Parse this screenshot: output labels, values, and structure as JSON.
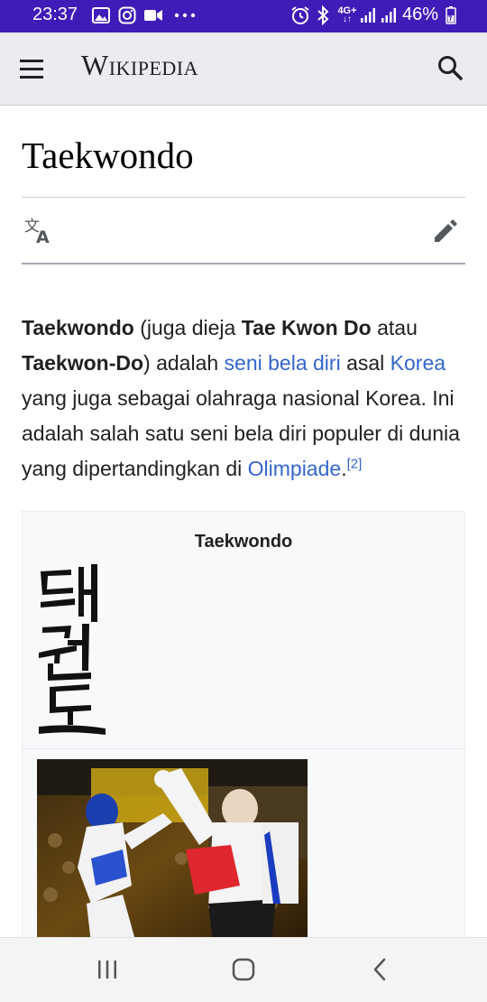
{
  "status_bar": {
    "time": "23:37",
    "network": "4G+",
    "battery": "46%",
    "icons": [
      "gallery-icon",
      "instagram-icon",
      "video-icon",
      "more-icon",
      "alarm-icon",
      "bluetooth-icon",
      "network-icon",
      "signal-icon",
      "signal-icon",
      "battery-icon"
    ],
    "background": "#3f1bb8"
  },
  "header": {
    "wordmark": "Wikipedia",
    "menu_icon": "menu-icon",
    "search_icon": "search-icon",
    "background": "#eaecf0"
  },
  "article": {
    "title": "Taekwondo",
    "language_icon": "language-icon",
    "edit_icon": "edit-icon",
    "lead": {
      "t1": "Taekwondo",
      "t2": " (juga dieja ",
      "t3": "Tae Kwon Do",
      "t4": " atau ",
      "t5": "Taekwon-Do",
      "t6": ") adalah ",
      "link1": "seni bela diri",
      "t7": " asal ",
      "link2": "Korea",
      "t8": " yang juga sebagai olahraga nasional Korea. Ini adalah salah satu seni bela diri populer di dunia yang dipertandingkan di ",
      "link3": "Olimpiade",
      "t9": ".",
      "ref": "[2]"
    },
    "link_color": "#3366cc"
  },
  "infobox": {
    "title": "Taekwondo",
    "hangul_text": "태권도"
  },
  "nav_bar": {
    "icons": [
      "recents-icon",
      "home-icon",
      "back-icon"
    ]
  }
}
